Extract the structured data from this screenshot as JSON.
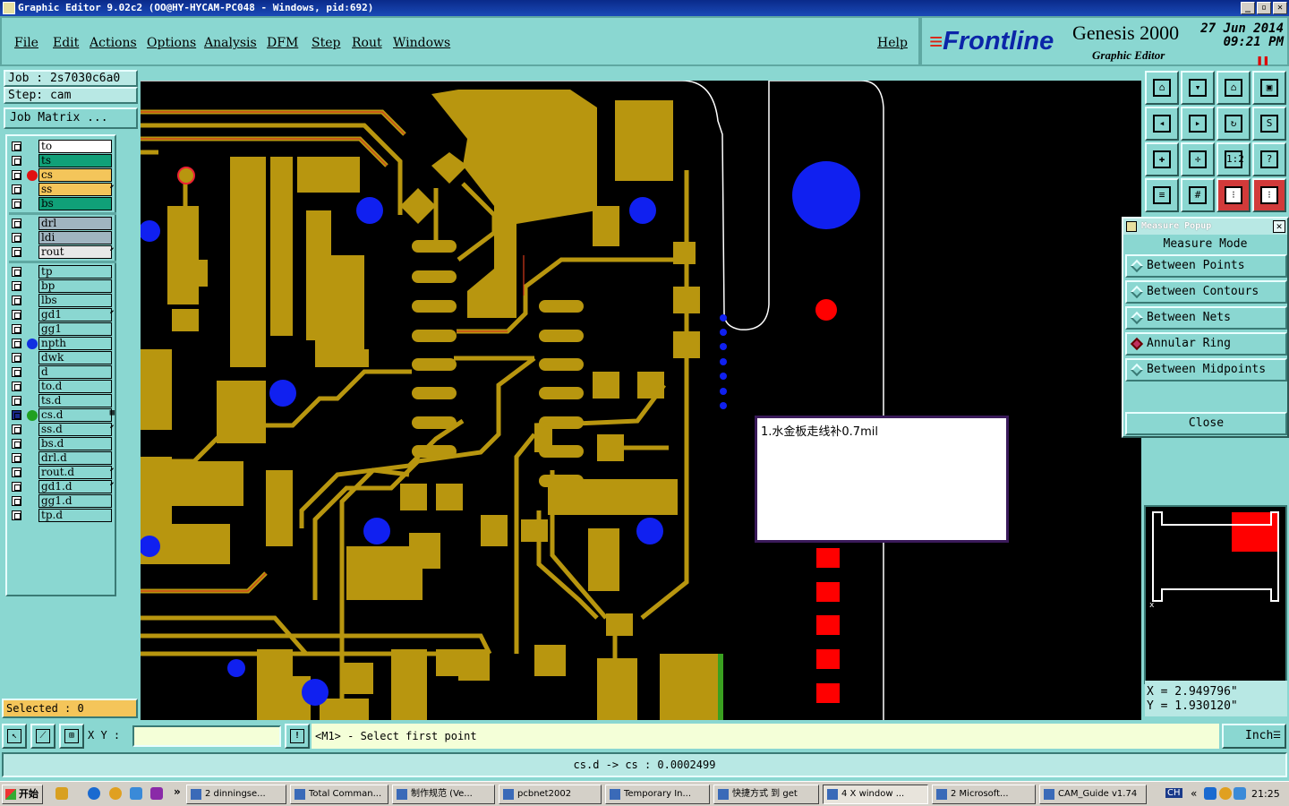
{
  "window": {
    "title": "Graphic Editor 9.02c2 (OO@HY-HYCAM-PC048 - Windows, pid:692)"
  },
  "menu": [
    {
      "label": "File",
      "name": "menu-file"
    },
    {
      "label": "Edit",
      "name": "menu-edit"
    },
    {
      "label": "Actions",
      "name": "menu-actions"
    },
    {
      "label": "Options",
      "name": "menu-options"
    },
    {
      "label": "Analysis",
      "name": "menu-analysis"
    },
    {
      "label": "DFM",
      "name": "menu-dfm"
    },
    {
      "label": "Step",
      "name": "menu-step"
    },
    {
      "label": "Rout",
      "name": "menu-rout"
    },
    {
      "label": "Windows",
      "name": "menu-windows"
    },
    {
      "label": "Help",
      "name": "menu-help"
    }
  ],
  "brand": {
    "logo": "Frontline",
    "product": "Genesis 2000",
    "subtitle": "Graphic Editor",
    "date": "27 Jun 2014",
    "time": "09:21 PM"
  },
  "job": {
    "job": "Job : 2s7030c6a0",
    "step": "Step: cam",
    "matrix": "Job Matrix ..."
  },
  "layers": [
    {
      "name": "to",
      "bg": "#ffffff",
      "dot": ""
    },
    {
      "name": "ts",
      "bg": "#10a078",
      "dot": ""
    },
    {
      "name": "cs",
      "bg": "#f4c55a",
      "dot": "#e01010"
    },
    {
      "name": "ss",
      "bg": "#f4c55a",
      "dot": "",
      "mark": "⬋"
    },
    {
      "name": "bs",
      "bg": "#10a078",
      "dot": ""
    },
    {
      "name": "drl",
      "bg": "#a0b4c0",
      "dot": "",
      "group": 1
    },
    {
      "name": "ldi",
      "bg": "#a0b4c0",
      "dot": "",
      "group": 1
    },
    {
      "name": "rout",
      "bg": "#e8e8e8",
      "dot": "",
      "mark": "⬋",
      "group": 1
    },
    {
      "name": "tp",
      "bg": "#8ad7d1",
      "dot": "",
      "group": 2
    },
    {
      "name": "bp",
      "bg": "#8ad7d1",
      "dot": "",
      "group": 2
    },
    {
      "name": "lbs",
      "bg": "#8ad7d1",
      "dot": "",
      "group": 2
    },
    {
      "name": "gd1",
      "bg": "#8ad7d1",
      "dot": "",
      "mark": "⬋",
      "group": 2
    },
    {
      "name": "gg1",
      "bg": "#8ad7d1",
      "dot": "",
      "group": 2
    },
    {
      "name": "npth",
      "bg": "#8ad7d1",
      "dot": "#1030e0",
      "group": 2
    },
    {
      "name": "dwk",
      "bg": "#8ad7d1",
      "dot": "",
      "group": 2
    },
    {
      "name": "d",
      "bg": "#8ad7d1",
      "dot": "",
      "group": 2
    },
    {
      "name": "to.d",
      "bg": "#8ad7d1",
      "dot": "",
      "group": 2
    },
    {
      "name": "ts.d",
      "bg": "#8ad7d1",
      "dot": "",
      "group": 2
    },
    {
      "name": "cs.d",
      "bg": "#8ad7d1",
      "dot": "#20a020",
      "mark": "▦",
      "group": 2,
      "checked": true
    },
    {
      "name": "ss.d",
      "bg": "#8ad7d1",
      "dot": "",
      "mark": "⬋",
      "group": 2
    },
    {
      "name": "bs.d",
      "bg": "#8ad7d1",
      "dot": "",
      "group": 2
    },
    {
      "name": "drl.d",
      "bg": "#8ad7d1",
      "dot": "",
      "group": 2
    },
    {
      "name": "rout.d",
      "bg": "#8ad7d1",
      "dot": "",
      "mark": "⬋",
      "group": 2
    },
    {
      "name": "gd1.d",
      "bg": "#8ad7d1",
      "dot": "",
      "mark": "⬋",
      "group": 2
    },
    {
      "name": "gg1.d",
      "bg": "#8ad7d1",
      "dot": "",
      "group": 2
    },
    {
      "name": "tp.d",
      "bg": "#8ad7d1",
      "dot": "",
      "group": 2
    }
  ],
  "selected": "Selected : 0",
  "measure": {
    "title": "Measure Popup",
    "mode_label": "Measure Mode",
    "options": [
      {
        "label": "Between Points",
        "active": false
      },
      {
        "label": "Between Contours",
        "active": false
      },
      {
        "label": "Between Nets",
        "active": false
      },
      {
        "label": "Annular Ring",
        "active": true
      },
      {
        "label": "Between Midpoints",
        "active": false
      }
    ],
    "close": "Close"
  },
  "note": "1.水金板走线补0.7mil",
  "coords": {
    "x": "X = 2.949796\"",
    "y": "Y = 1.930120\""
  },
  "bottom": {
    "xy_label": "X Y :",
    "xy_value": "",
    "prompt": "<M1> - Select first point",
    "units": "Inch"
  },
  "status": "cs.d -> cs : 0.0002499",
  "tools": [
    {
      "icon": "zoom-home-icon",
      "glyph": "⌂"
    },
    {
      "icon": "zoom-in-icon",
      "glyph": "▾"
    },
    {
      "icon": "home-view-icon",
      "glyph": "⌂"
    },
    {
      "icon": "fit-icon",
      "glyph": "▣"
    },
    {
      "icon": "pan-left-icon",
      "glyph": "◂"
    },
    {
      "icon": "pan-right-icon",
      "glyph": "▸"
    },
    {
      "icon": "redraw-icon",
      "glyph": "↻"
    },
    {
      "icon": "snap-icon",
      "glyph": "S"
    },
    {
      "icon": "zoom-box-icon",
      "glyph": "✚"
    },
    {
      "icon": "center-icon",
      "glyph": "✛"
    },
    {
      "icon": "ratio-icon",
      "glyph": "1:2"
    },
    {
      "icon": "query-icon",
      "glyph": "?"
    },
    {
      "icon": "snap-settings-icon",
      "glyph": "≡"
    },
    {
      "icon": "grid-icon",
      "glyph": "#"
    },
    {
      "icon": "feature-select-icon",
      "glyph": "⁝"
    },
    {
      "icon": "net-select-icon",
      "glyph": "⁝"
    }
  ],
  "taskbar": {
    "start": "开始",
    "items": [
      {
        "label": "2 dinningse...",
        "w": 112
      },
      {
        "label": "Total Comman...",
        "w": 110
      },
      {
        "label": "制作规范 (Ve...",
        "w": 115
      },
      {
        "label": "pcbnet2002",
        "w": 115
      },
      {
        "label": "Temporary In...",
        "w": 117
      },
      {
        "label": "快捷方式 到 get",
        "w": 118
      },
      {
        "label": "4 X window ...",
        "w": 118,
        "active": true
      },
      {
        "label": "2 Microsoft...",
        "w": 116
      },
      {
        "label": "CAM_Guide v1.74",
        "w": 120
      }
    ],
    "lang": "CH",
    "clock": "21:25"
  },
  "colors": {
    "copper": "#b8960f",
    "hole": "#1020f0",
    "pad_red": "#f00",
    "board_outline": "#ffffff"
  }
}
